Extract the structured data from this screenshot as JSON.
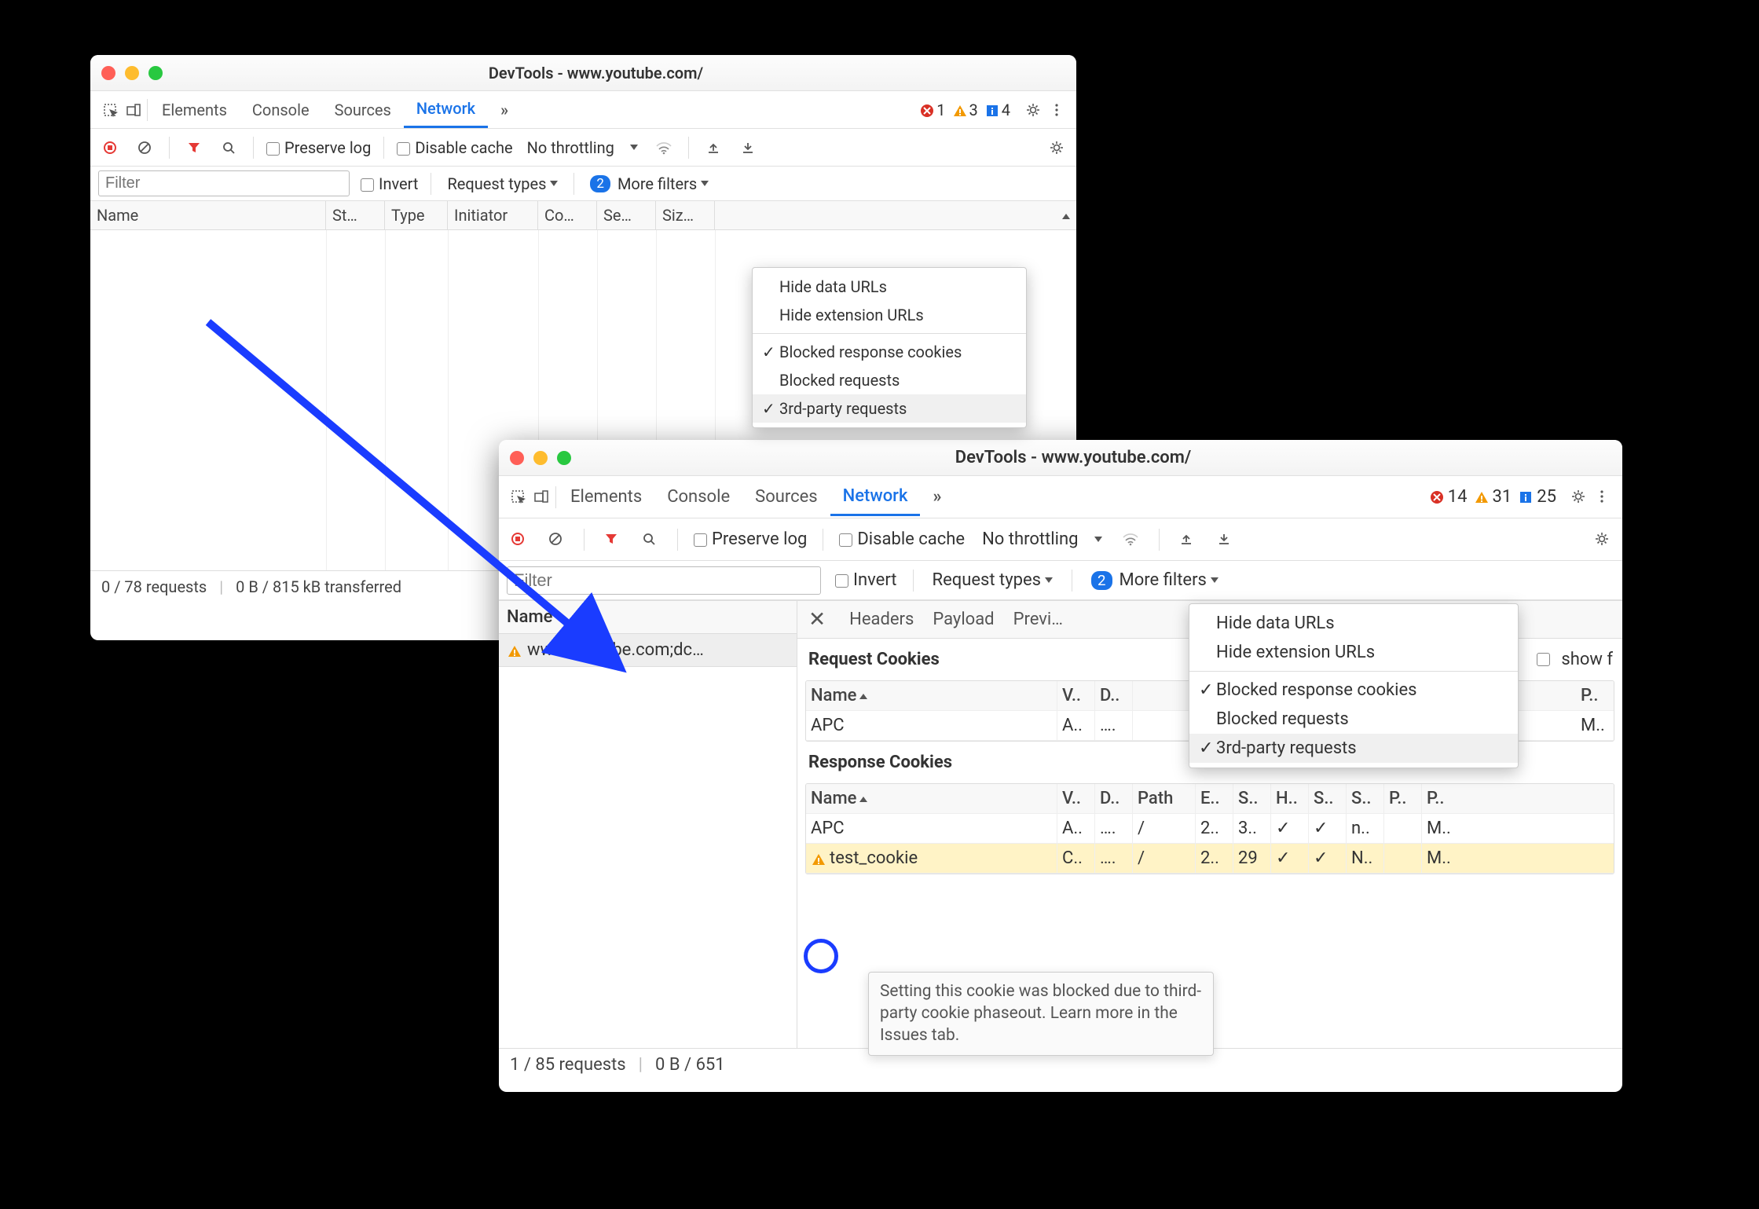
{
  "win1": {
    "title": "DevTools - www.youtube.com/",
    "tabs": [
      "Elements",
      "Console",
      "Sources",
      "Network"
    ],
    "active_tab": "Network",
    "errors": 1,
    "warnings": 3,
    "info": 4,
    "toolbar": {
      "preserve": "Preserve log",
      "disable": "Disable cache",
      "throttle": "No throttling"
    },
    "filter": {
      "placeholder": "Filter",
      "invert": "Invert",
      "reqtypes": "Request types",
      "more": "More filters",
      "badge": 2
    },
    "cols": [
      "Name",
      "St…",
      "Type",
      "Initiator",
      "Co…",
      "Se…",
      "Siz…"
    ],
    "popup": {
      "items": [
        {
          "label": "Hide data URLs",
          "check": false
        },
        {
          "label": "Hide extension URLs",
          "check": false
        },
        "div",
        {
          "label": "Blocked response cookies",
          "check": true
        },
        {
          "label": "Blocked requests",
          "check": false
        },
        {
          "label": "3rd-party requests",
          "check": true,
          "hover": true
        }
      ]
    },
    "status": {
      "reqs": "0 / 78 requests",
      "xfer1": "0 B / 815 kB transferred"
    }
  },
  "win2": {
    "title": "DevTools - www.youtube.com/",
    "tabs": [
      "Elements",
      "Console",
      "Sources",
      "Network"
    ],
    "active_tab": "Network",
    "errors": 14,
    "warnings": 31,
    "info": 25,
    "toolbar": {
      "preserve": "Preserve log",
      "disable": "Disable cache",
      "throttle": "No throttling"
    },
    "filter": {
      "placeholder": "Filter",
      "invert": "Invert",
      "reqtypes": "Request types",
      "more": "More filters",
      "badge": 2
    },
    "popup": {
      "items": [
        {
          "label": "Hide data URLs",
          "check": false
        },
        {
          "label": "Hide extension URLs",
          "check": false
        },
        "div",
        {
          "label": "Blocked response cookies",
          "check": true
        },
        {
          "label": "Blocked requests",
          "check": false
        },
        {
          "label": "3rd-party requests",
          "check": true,
          "hover": true
        }
      ]
    },
    "reqlist": {
      "header": "Name",
      "item": "www.youtube.com;dc…"
    },
    "detail_tabs": [
      "Headers",
      "Payload",
      "Previ…"
    ],
    "section_request": "Request Cookies",
    "show_filtered": "show f",
    "req_cookies": {
      "head": [
        "Name",
        "V..",
        "D.."
      ],
      "tail": [
        "P.."
      ],
      "rows": [
        {
          "name": "APC",
          "v": "A..",
          "d": "….",
          "p": "M.."
        }
      ]
    },
    "section_response": "Response Cookies",
    "resp_cookies": {
      "head": [
        "Name",
        "V..",
        "D..",
        "Path",
        "E..",
        "S..",
        "H..",
        "S..",
        "S..",
        "P..",
        "P.."
      ],
      "rows": [
        {
          "name": "APC",
          "cells": [
            "A..",
            "….",
            "/",
            "2..",
            "3..",
            "✓",
            "✓",
            "n..",
            "",
            "M.."
          ]
        },
        {
          "name": "test_cookie",
          "warn": true,
          "cells": [
            "C..",
            "….",
            "/",
            "2..",
            "29",
            "✓",
            "✓",
            "N..",
            "",
            "M.."
          ]
        }
      ]
    },
    "tooltip": "Setting this cookie was blocked due to third-party cookie phaseout. Learn more in the Issues tab.",
    "status": {
      "reqs": "1 / 85 requests",
      "xfer": "0 B / 651"
    }
  }
}
